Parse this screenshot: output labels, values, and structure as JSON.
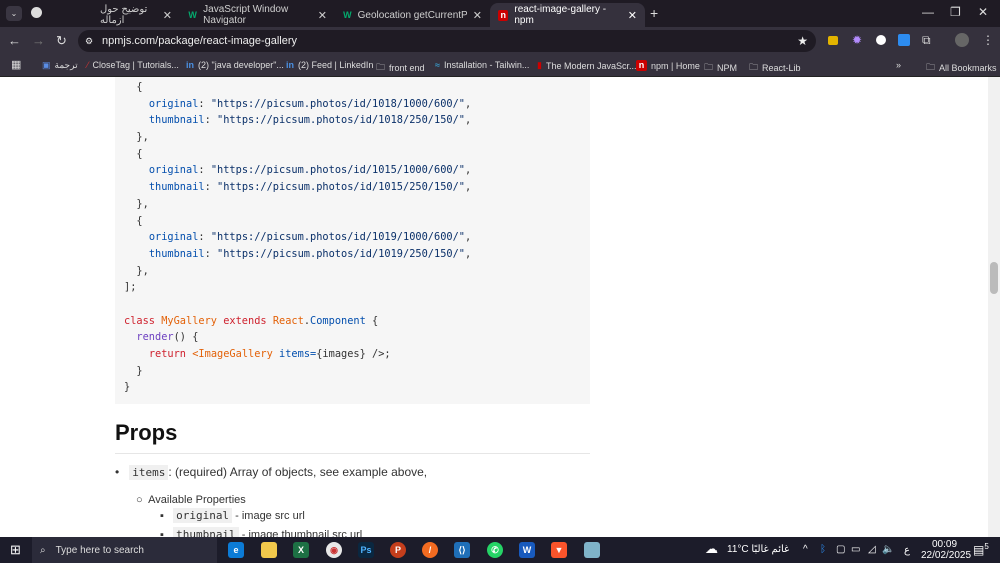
{
  "tabs": [
    {
      "title": "توضيح حول ازماله",
      "favicon": "globe-icon"
    },
    {
      "title": "JavaScript Window Navigator",
      "favicon": "w3schools-icon"
    },
    {
      "title": "Geolocation getCurrentPosition",
      "favicon": "w3schools-icon"
    },
    {
      "title": "react-image-gallery - npm",
      "favicon": "npm-icon",
      "active": true
    }
  ],
  "address": {
    "url": "npmjs.com/package/react-image-gallery"
  },
  "bookmarks": [
    "ترجمة",
    "CloseTag | Tutorials...",
    "(2) \"java developer\"...",
    "(2) Feed | LinkedIn",
    "front end",
    "Installation - Tailwin...",
    "The Modern JavaScr...",
    "npm | Home",
    "NPM",
    "React-Lib"
  ],
  "all_bookmarks": "All Bookmarks",
  "code_lines": [
    [
      [
        "  {",
        ""
      ]
    ],
    [
      [
        "    ",
        ""
      ],
      [
        "original",
        "prop"
      ],
      [
        ": ",
        ""
      ],
      [
        "\"https://picsum.photos/id/1018/1000/600/\"",
        "str"
      ],
      [
        ",",
        ""
      ]
    ],
    [
      [
        "    ",
        ""
      ],
      [
        "thumbnail",
        "prop"
      ],
      [
        ": ",
        ""
      ],
      [
        "\"https://picsum.photos/id/1018/250/150/\"",
        "str"
      ],
      [
        ",",
        ""
      ]
    ],
    [
      [
        "  },",
        ""
      ]
    ],
    [
      [
        "  {",
        ""
      ]
    ],
    [
      [
        "    ",
        ""
      ],
      [
        "original",
        "prop"
      ],
      [
        ": ",
        ""
      ],
      [
        "\"https://picsum.photos/id/1015/1000/600/\"",
        "str"
      ],
      [
        ",",
        ""
      ]
    ],
    [
      [
        "    ",
        ""
      ],
      [
        "thumbnail",
        "prop"
      ],
      [
        ": ",
        ""
      ],
      [
        "\"https://picsum.photos/id/1015/250/150/\"",
        "str"
      ],
      [
        ",",
        ""
      ]
    ],
    [
      [
        "  },",
        ""
      ]
    ],
    [
      [
        "  {",
        ""
      ]
    ],
    [
      [
        "    ",
        ""
      ],
      [
        "original",
        "prop"
      ],
      [
        ": ",
        ""
      ],
      [
        "\"https://picsum.photos/id/1019/1000/600/\"",
        "str"
      ],
      [
        ",",
        ""
      ]
    ],
    [
      [
        "    ",
        ""
      ],
      [
        "thumbnail",
        "prop"
      ],
      [
        ": ",
        ""
      ],
      [
        "\"https://picsum.photos/id/1019/250/150/\"",
        "str"
      ],
      [
        ",",
        ""
      ]
    ],
    [
      [
        "  },",
        ""
      ]
    ],
    [
      [
        "];",
        ""
      ]
    ],
    [
      [
        "",
        ""
      ]
    ],
    [
      [
        "class",
        "kw"
      ],
      [
        " ",
        ""
      ],
      [
        "MyGallery",
        "cls"
      ],
      [
        " ",
        ""
      ],
      [
        "extends",
        "kw"
      ],
      [
        " ",
        ""
      ],
      [
        "React",
        "cls"
      ],
      [
        ".",
        ""
      ],
      [
        "Component",
        "prop"
      ],
      [
        " {",
        ""
      ]
    ],
    [
      [
        "  ",
        ""
      ],
      [
        "render",
        "fn"
      ],
      [
        "() {",
        ""
      ]
    ],
    [
      [
        "    ",
        ""
      ],
      [
        "return",
        "kw"
      ],
      [
        " ",
        ""
      ],
      [
        "<ImageGallery",
        "tag"
      ],
      [
        " ",
        ""
      ],
      [
        "items=",
        "prop"
      ],
      [
        "{images} />;",
        ""
      ]
    ],
    [
      [
        "  }",
        ""
      ]
    ],
    [
      [
        "}",
        ""
      ]
    ]
  ],
  "props": {
    "heading": "Props",
    "items_code": "items",
    "items_desc": ": (required) Array of objects, see example above,",
    "available": "Available Properties",
    "original_code": "original",
    "original_desc": " - image src url",
    "thumbnail_code": "thumbnail",
    "thumbnail_desc": " - image thumbnail src url"
  },
  "taskbar": {
    "search_placeholder": "Type here to search",
    "weather": "11°C  غائم غالبًا",
    "lang": "ع",
    "time": "00:09",
    "date": "22/02/2025",
    "notifications": "5"
  }
}
